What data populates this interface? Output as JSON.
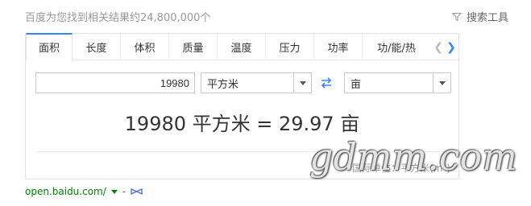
{
  "header": {
    "result_count": "百度为您找到相关结果约24,800,000个",
    "search_tools_label": "搜索工具",
    "search_tools_icon": "filter-icon"
  },
  "converter": {
    "tabs": [
      {
        "label": "面积",
        "active": true
      },
      {
        "label": "长度",
        "active": false
      },
      {
        "label": "体积",
        "active": false
      },
      {
        "label": "质量",
        "active": false
      },
      {
        "label": "温度",
        "active": false
      },
      {
        "label": "压力",
        "active": false
      },
      {
        "label": "功率",
        "active": false
      },
      {
        "label": "功/能/热",
        "active": false
      }
    ],
    "prev_icon": "chevron-left-icon",
    "next_icon": "chevron-right-icon",
    "input_value": "19980",
    "from_unit": "平方米",
    "to_unit": "亩",
    "swap_icon": "swap-arrows-icon",
    "result_text": "19980 平方米 = 29.97 亩",
    "intl_unit_note": "国际单位：平方米(m²)",
    "accent_color": "#3385ff"
  },
  "footer": {
    "source_url": "open.baidu.com/",
    "separator": "-",
    "bow_icon": "bow-icon",
    "source_color": "#008000"
  },
  "watermark": {
    "text": "gdmm.com"
  }
}
